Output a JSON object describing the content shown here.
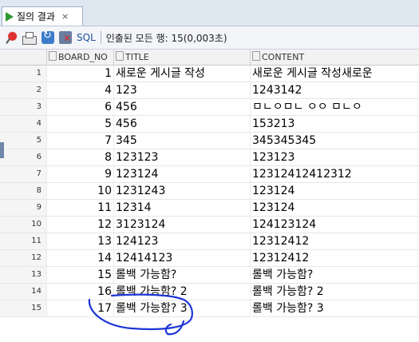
{
  "tab": {
    "label": "질의 결과",
    "close": "×"
  },
  "toolbar": {
    "sql_label": "SQL",
    "fetch_info": "인출된 모든 행: 15(0,003초)"
  },
  "grid": {
    "columns": [
      "BOARD_NO",
      "TITLE",
      "CONTENT"
    ],
    "rows": [
      {
        "rn": "1",
        "board_no": "1",
        "title": "새로운 게시글 작성",
        "content": "새로운 게시글 작성새로운"
      },
      {
        "rn": "2",
        "board_no": "4",
        "title": "123",
        "content": "1243142"
      },
      {
        "rn": "3",
        "board_no": "6",
        "title": "456",
        "content": "ㅁㄴㅇㅁㄴ ㅇㅇ ㅁㄴㅇ"
      },
      {
        "rn": "4",
        "board_no": "5",
        "title": "456",
        "content": "153213"
      },
      {
        "rn": "5",
        "board_no": "7",
        "title": "345",
        "content": "345345345"
      },
      {
        "rn": "6",
        "board_no": "8",
        "title": "123123",
        "content": "123123"
      },
      {
        "rn": "7",
        "board_no": "9",
        "title": "123124",
        "content": "12312412412312"
      },
      {
        "rn": "8",
        "board_no": "10",
        "title": "1231243",
        "content": "123124"
      },
      {
        "rn": "9",
        "board_no": "11",
        "title": "12314",
        "content": "123124"
      },
      {
        "rn": "10",
        "board_no": "12",
        "title": "3123124",
        "content": "124123124"
      },
      {
        "rn": "11",
        "board_no": "13",
        "title": "124123",
        "content": "12312412"
      },
      {
        "rn": "12",
        "board_no": "14",
        "title": "12414123",
        "content": "12312412"
      },
      {
        "rn": "13",
        "board_no": "15",
        "title": "롤백 가능함?",
        "content": "롤백 가능함?"
      },
      {
        "rn": "14",
        "board_no": "16",
        "title": "롤백 가능함? 2",
        "content": "롤백 가능함? 2"
      },
      {
        "rn": "15",
        "board_no": "17",
        "title": "롤백 가능함? 3",
        "content": "롤백 가능함? 3"
      }
    ]
  },
  "colors": {
    "tab_bg": "#dfe7f1",
    "play_green": "#2e9a2e",
    "sql_blue": "#1d4f9c",
    "scribble_blue": "#1d35d6"
  }
}
